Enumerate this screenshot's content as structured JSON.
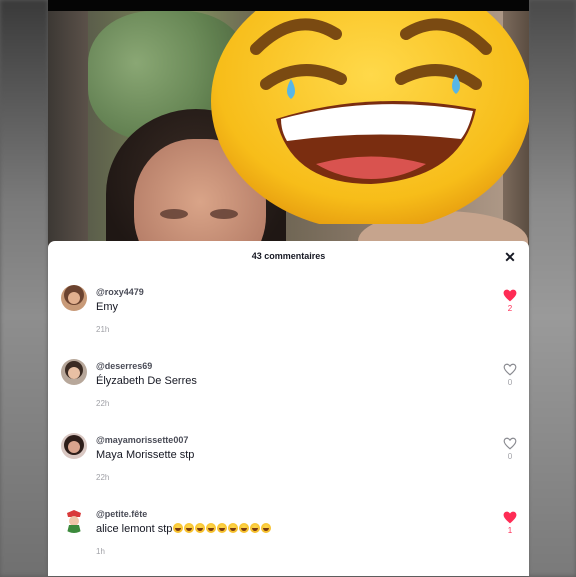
{
  "panel": {
    "title": "43 commentaires",
    "close_icon": "close-icon"
  },
  "comments": [
    {
      "username": "@roxy4479",
      "text": "Emy",
      "time": "21h",
      "likes": "2",
      "liked": true
    },
    {
      "username": "@deserres69",
      "text": "Élyzabeth De Serres",
      "time": "22h",
      "likes": "0",
      "liked": false
    },
    {
      "username": "@mayamorissette007",
      "text": "Maya Morissette stp",
      "time": "22h",
      "likes": "0",
      "liked": false
    },
    {
      "username": "@petite.fête",
      "text": "alice lemont stp",
      "emoji_count": 9,
      "time": "1h",
      "likes": "1",
      "liked": true
    }
  ],
  "colors": {
    "liked": "#fe2c55",
    "unliked": "#a0a1a7",
    "emoji_yellow": "#fcc21b"
  }
}
